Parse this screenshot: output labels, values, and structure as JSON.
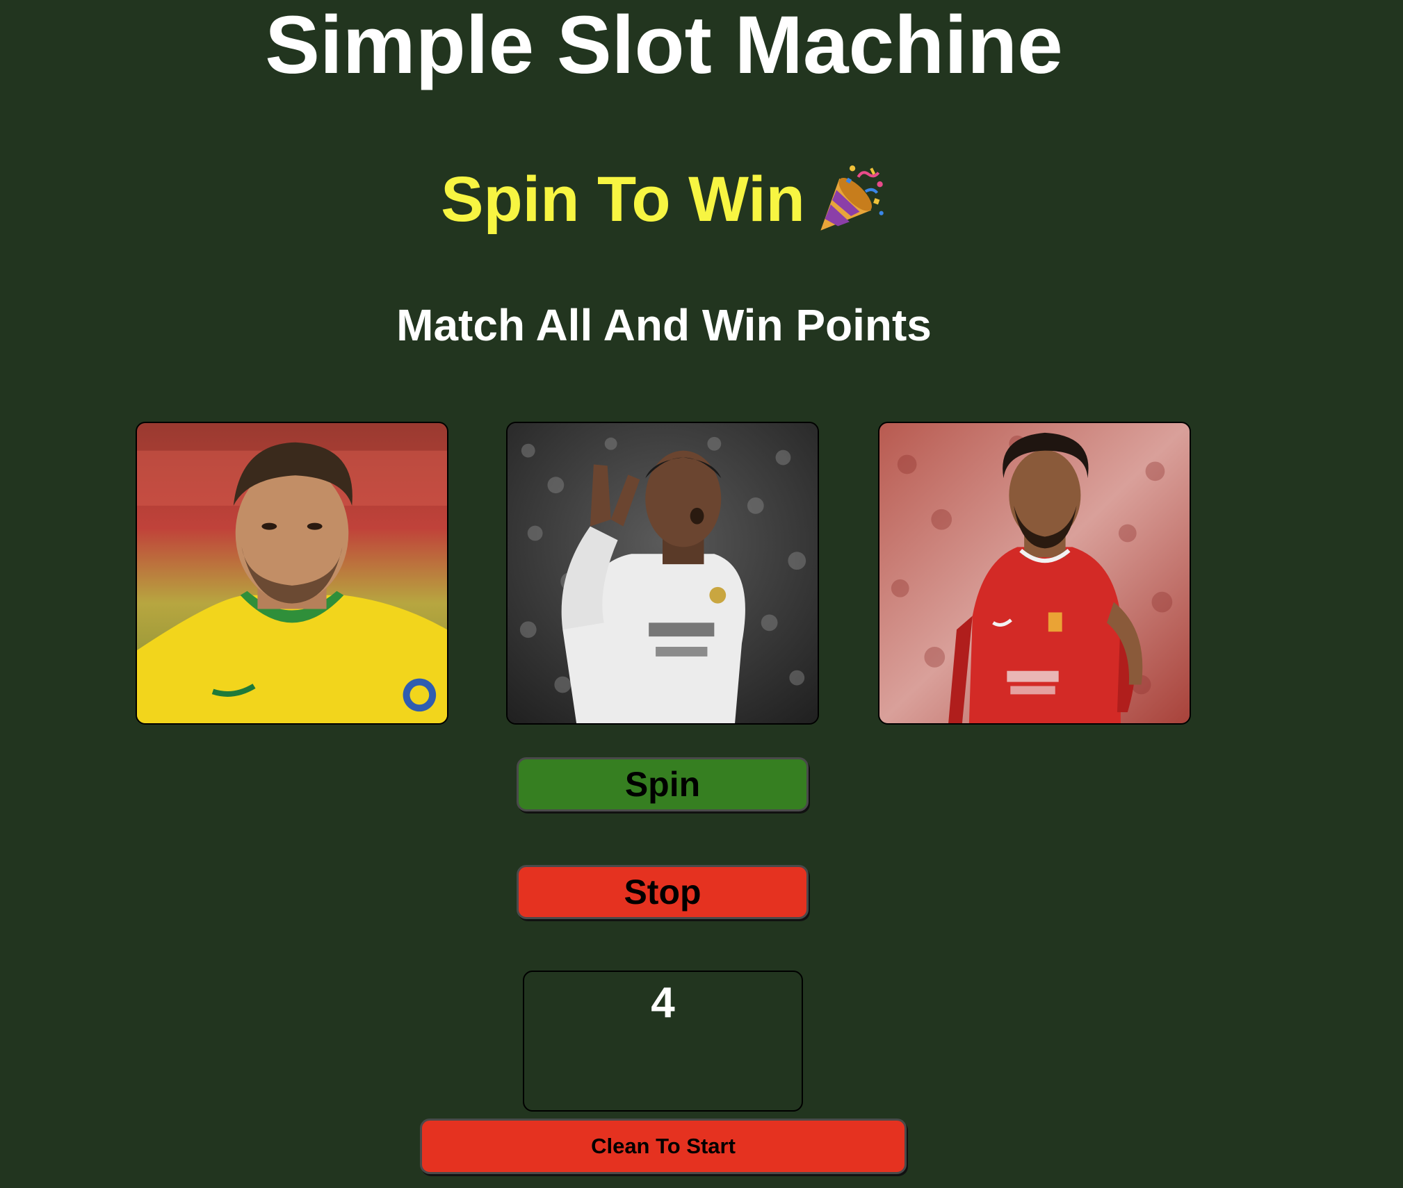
{
  "header": {
    "title": "Simple Slot Machine",
    "subtitle": "Spin To Win",
    "subtitle_icon": "party-popper-icon",
    "tagline": "Match All And Win Points"
  },
  "reels": [
    {
      "name": "reel-1",
      "image": "player-yellow-jersey"
    },
    {
      "name": "reel-2",
      "image": "player-white-jersey"
    },
    {
      "name": "reel-3",
      "image": "player-red-jersey"
    }
  ],
  "controls": {
    "spin_label": "Spin",
    "stop_label": "Stop",
    "clean_label": "Clean To Start"
  },
  "score": {
    "value": "4"
  },
  "colors": {
    "background": "#22351f",
    "title": "#ffffff",
    "subtitle": "#f7f542",
    "spin_button": "#367f21",
    "stop_button": "#e53220",
    "clean_button": "#e53220"
  }
}
